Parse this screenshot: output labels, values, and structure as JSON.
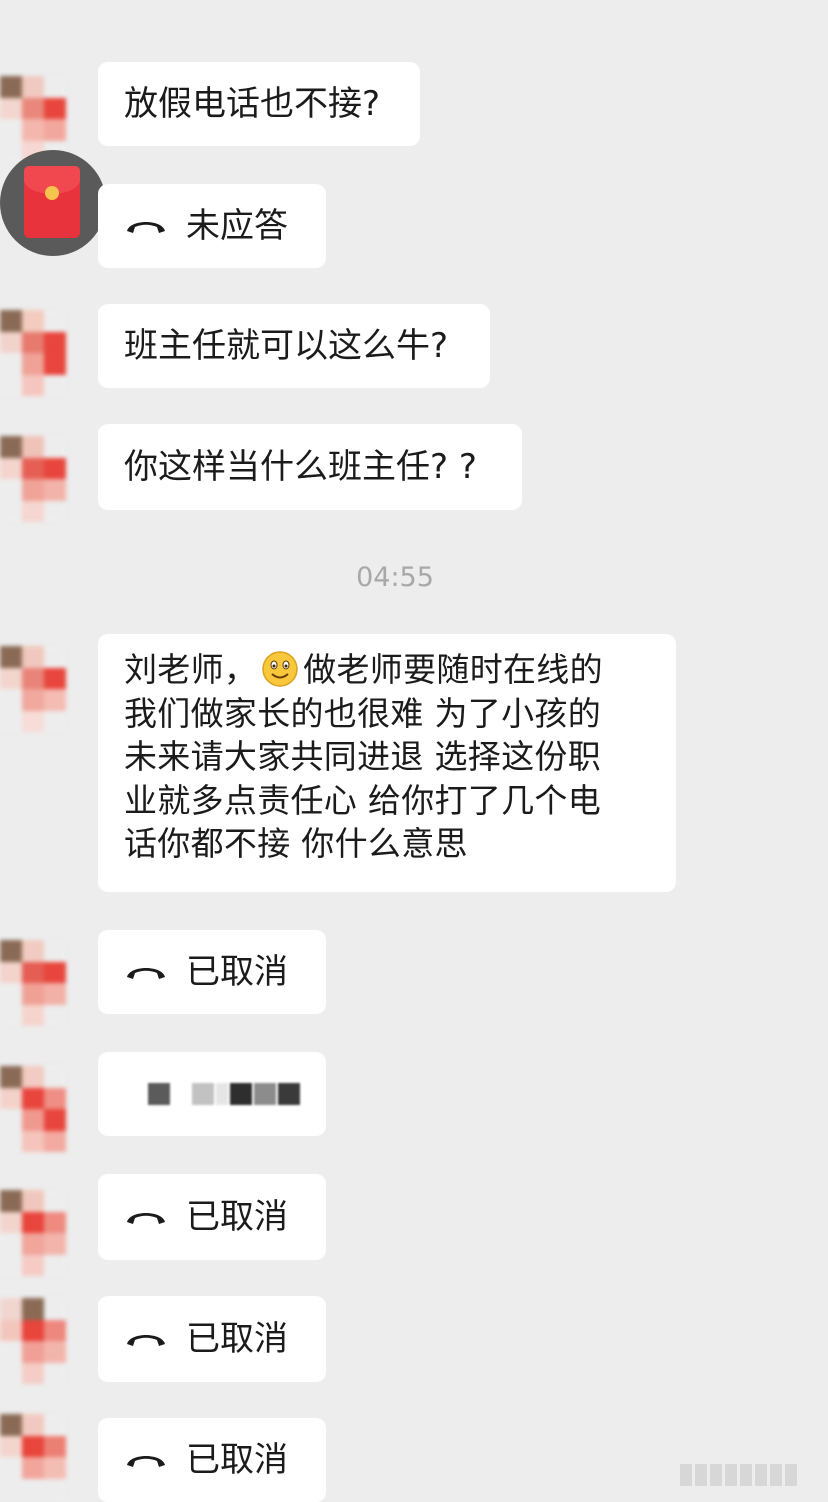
{
  "messages": [
    {
      "type": "text",
      "text": "放假电话也不接?"
    },
    {
      "type": "call",
      "icon": "phone-hangup-icon",
      "text": "未应答"
    },
    {
      "type": "text",
      "text": "班主任就可以这么牛?"
    },
    {
      "type": "text",
      "text": "你这样当什么班主任? ?"
    },
    {
      "type": "multiline",
      "lines": [
        "刘老师，",
        "做老师要随时在线的",
        "我们做家长的也很难 为了小孩的",
        "未来请大家共同进退 选择这份职",
        "业就多点责任心 给你打了几个电",
        "话你都不接 你什么意思"
      ],
      "emoji": "smile-emoji"
    },
    {
      "type": "call",
      "icon": "phone-hangup-icon",
      "text": "已取消"
    },
    {
      "type": "mosaic"
    },
    {
      "type": "call",
      "icon": "phone-hangup-icon",
      "text": "已取消"
    },
    {
      "type": "call",
      "icon": "phone-hangup-icon",
      "text": "已取消"
    },
    {
      "type": "call",
      "icon": "phone-hangup-icon",
      "text": "已取消"
    }
  ],
  "timestamp": "04:55",
  "colors": {
    "background": "#ededed",
    "bubble": "#ffffff",
    "text": "#1b1b1b",
    "timestamp": "#a8a8a8",
    "avatar_red": "#e8453c",
    "avatar_brown": "#8a6a55"
  }
}
